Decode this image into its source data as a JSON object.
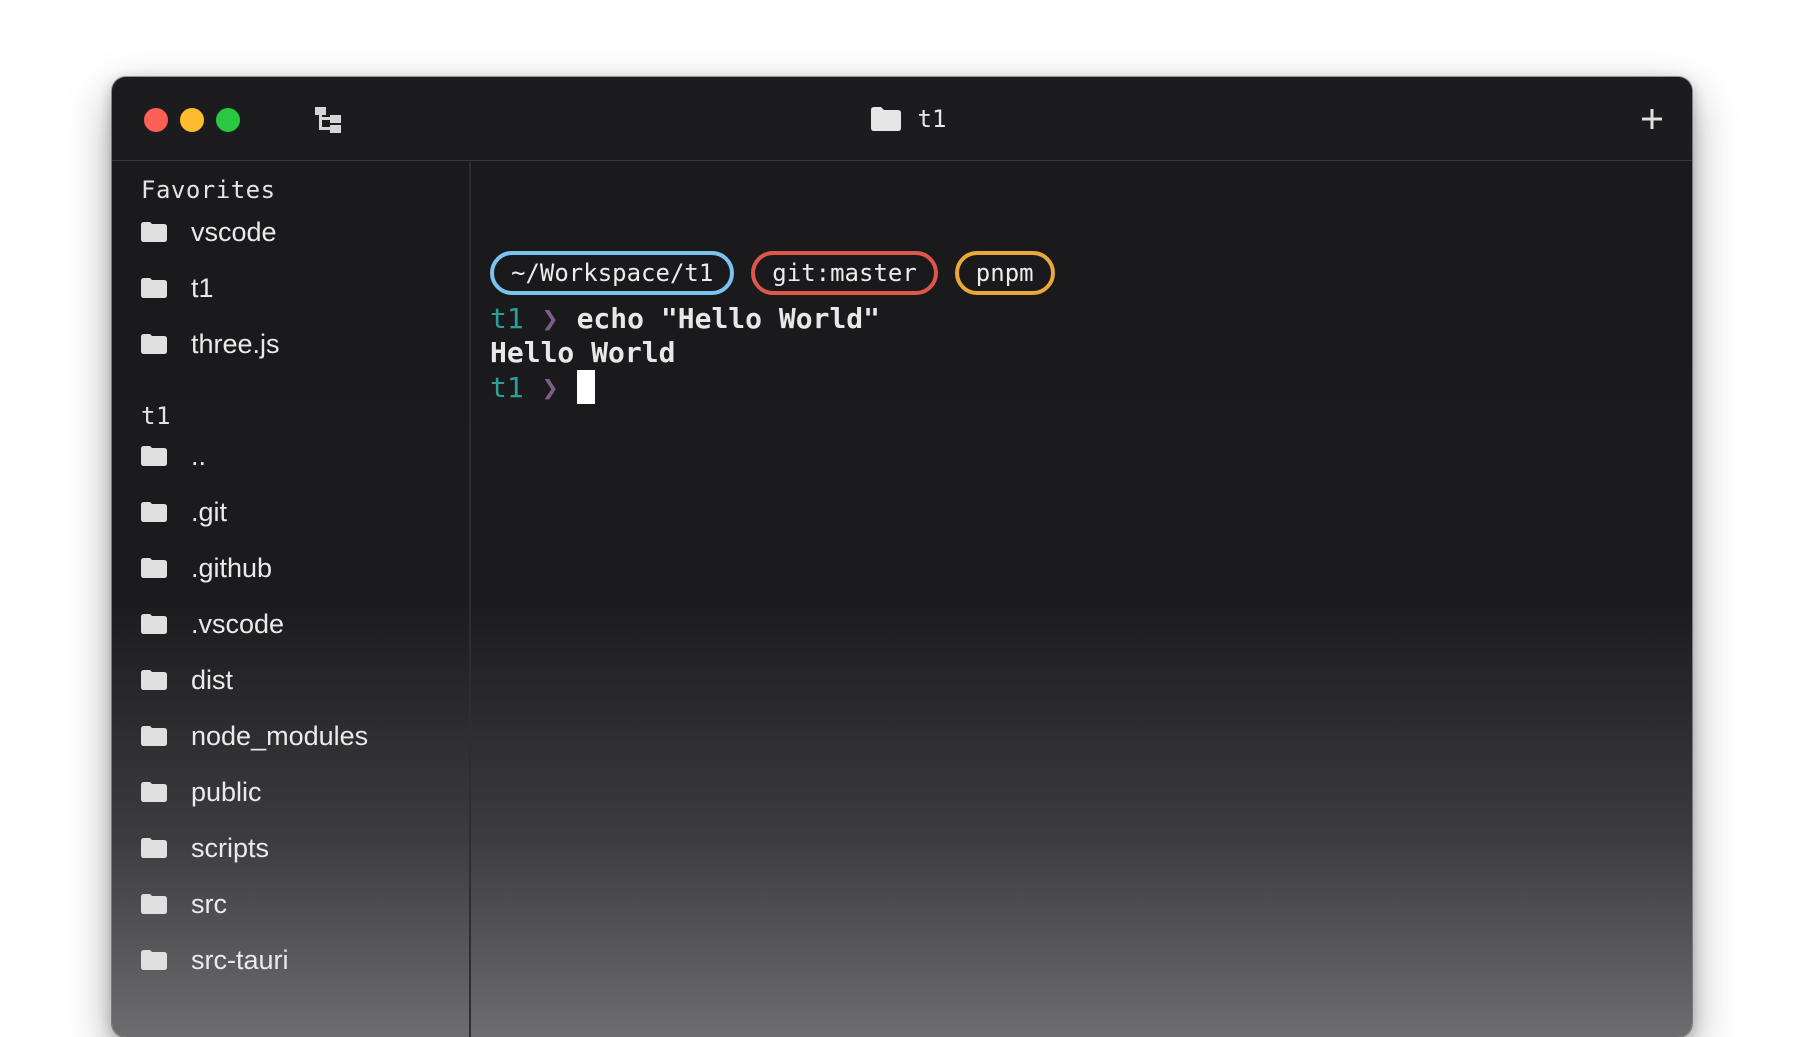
{
  "window": {
    "title": "t1",
    "title_icon": "folder-icon",
    "traffic_lights": [
      "close",
      "minimize",
      "zoom"
    ],
    "colors": {
      "close": "#fe5f57",
      "minimize": "#febc2e",
      "zoom": "#28c840"
    }
  },
  "sidebar": {
    "favorites_title": "Favorites",
    "favorites": [
      {
        "label": "vscode",
        "icon": "folder-icon"
      },
      {
        "label": "t1",
        "icon": "folder-icon"
      },
      {
        "label": "three.js",
        "icon": "folder-icon"
      }
    ],
    "current_title": "t1",
    "entries": [
      {
        "label": "..",
        "icon": "folder-icon"
      },
      {
        "label": ".git",
        "icon": "folder-icon"
      },
      {
        "label": ".github",
        "icon": "folder-icon"
      },
      {
        "label": ".vscode",
        "icon": "folder-icon"
      },
      {
        "label": "dist",
        "icon": "folder-icon"
      },
      {
        "label": "node_modules",
        "icon": "folder-icon"
      },
      {
        "label": "public",
        "icon": "folder-icon"
      },
      {
        "label": "scripts",
        "icon": "folder-icon"
      },
      {
        "label": "src",
        "icon": "folder-icon"
      },
      {
        "label": "src-tauri",
        "icon": "folder-icon"
      }
    ]
  },
  "terminal": {
    "badges": [
      {
        "text": "~/Workspace/t1",
        "color": "#7cc4f0"
      },
      {
        "text": "git:master",
        "color": "#e0564a"
      },
      {
        "text": "pnpm",
        "color": "#eaa73a"
      }
    ],
    "prompt_dir": "t1",
    "prompt_arrow": "❯",
    "command": "echo \"Hello World\"",
    "output": "Hello World",
    "prompt_colors": {
      "dir": "#2aa198",
      "arrow": "#7d5d8a"
    }
  }
}
